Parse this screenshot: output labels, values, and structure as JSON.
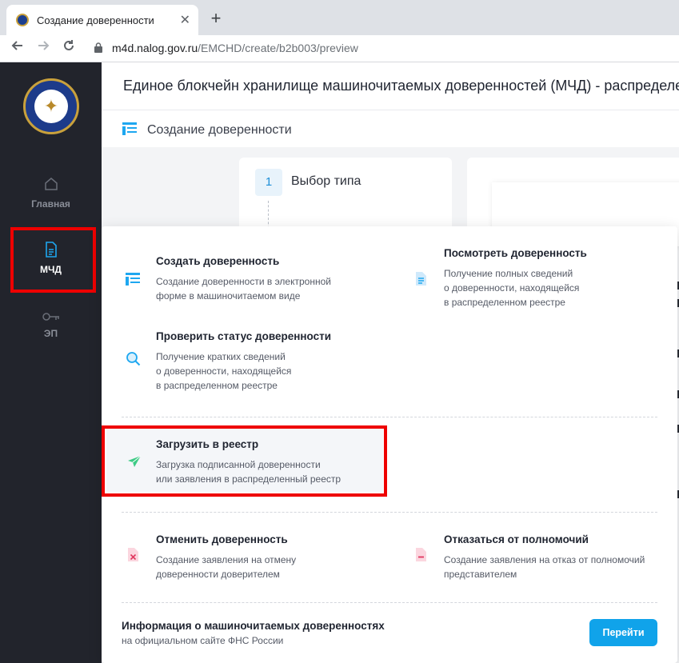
{
  "browser": {
    "tab_title": "Создание доверенности",
    "tab_close": "✕",
    "new_tab": "+",
    "url_host": "m4d.nalog.gov.ru",
    "url_path": "/EMCHD/create/b2b003/preview"
  },
  "sidebar": {
    "items": [
      {
        "label": "Главная",
        "icon": "home-icon",
        "active": false
      },
      {
        "label": "МЧД",
        "icon": "document-icon",
        "active": true
      },
      {
        "label": "ЭП",
        "icon": "key-icon",
        "active": false
      }
    ]
  },
  "header": {
    "site_title": "Единое блокчейн хранилище машиночитаемых доверенностей (МЧД) - распределе",
    "page_title": "Создание доверенности"
  },
  "stepper": {
    "step_number": "1",
    "step_label": "Выбор типа"
  },
  "menu": {
    "create": {
      "title": "Создать доверенность",
      "desc1": "Создание доверенности в электронной",
      "desc2": "форме в машиночитаемом виде"
    },
    "view": {
      "title": "Посмотреть доверенность",
      "desc1": "Получение полных сведений",
      "desc2": "о доверенности, находящейся",
      "desc3": "в распределенном реестре"
    },
    "check": {
      "title": "Проверить статус доверенности",
      "desc1": "Получение кратких сведений",
      "desc2": "о доверенности, находящейся",
      "desc3": "в распределенном реестре"
    },
    "upload": {
      "title": "Загрузить в реестр",
      "desc1": "Загрузка подписанной доверенности",
      "desc2": "или заявления в распределенный реестр"
    },
    "revoke": {
      "title": "Отменить доверенность",
      "desc1": "Создание заявления на отмену",
      "desc2": "доверенности доверителем"
    },
    "refuse": {
      "title": "Отказаться от полномочий",
      "desc1": "Создание заявления на отказ от полномочий",
      "desc2": "представителем"
    }
  },
  "info": {
    "title": "Информация о машиночитаемых доверенностях",
    "subtitle": "на официальном сайте ФНС России",
    "button_label": "Перейти"
  },
  "colors": {
    "accent": "#10a3ea",
    "sidebar_bg": "#22242c",
    "highlight": "#e00000"
  }
}
